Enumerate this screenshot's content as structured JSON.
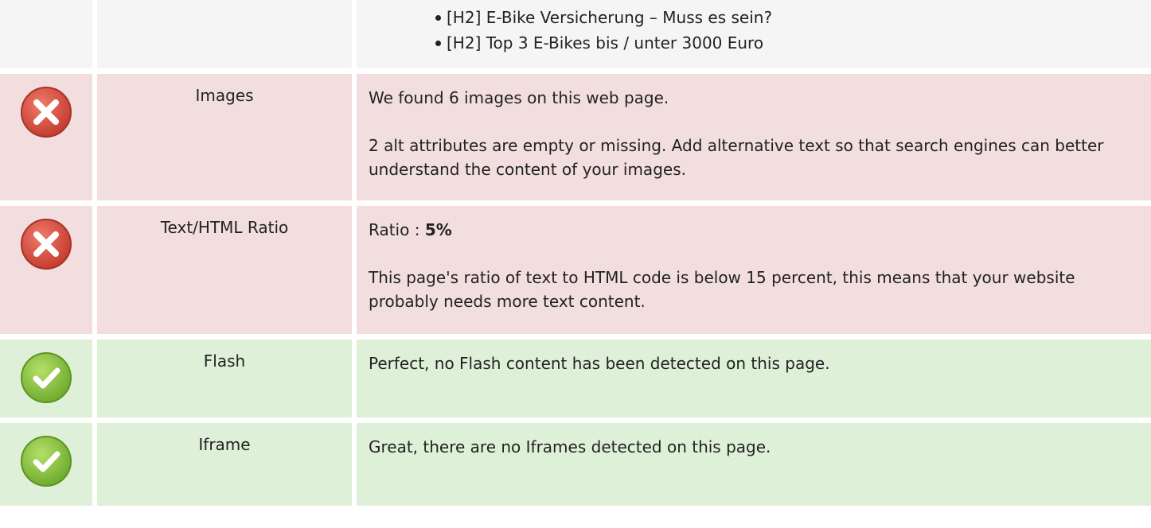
{
  "headings_list": {
    "items": [
      "[H2] E-Bike Versicherung – Muss es sein?",
      "[H2] Top 3 E-Bikes bis / unter 3000 Euro"
    ]
  },
  "images": {
    "status_icon": "error-x-icon",
    "label": "Images",
    "summary": "We found 6 images on this web page.",
    "detail": "2 alt attributes are empty or missing. Add alternative text so that search engines can better understand the content of your images."
  },
  "text_html_ratio": {
    "status_icon": "error-x-icon",
    "label": "Text/HTML Ratio",
    "ratio_prefix": "Ratio : ",
    "ratio_value": "5%",
    "detail": "This page's ratio of text to HTML code is below 15 percent, this means that your website probably needs more text content."
  },
  "flash": {
    "status_icon": "check-icon",
    "label": "Flash",
    "detail": "Perfect, no Flash content has been detected on this page."
  },
  "iframe": {
    "status_icon": "check-icon",
    "label": "Iframe",
    "detail": "Great, there are no Iframes detected on this page."
  },
  "colors": {
    "error_bg": "#f2dede",
    "ok_bg": "#dff0d8",
    "neutral_bg": "#f5f5f5",
    "error_icon": "#d9534f",
    "ok_icon": "#8cc63f"
  }
}
